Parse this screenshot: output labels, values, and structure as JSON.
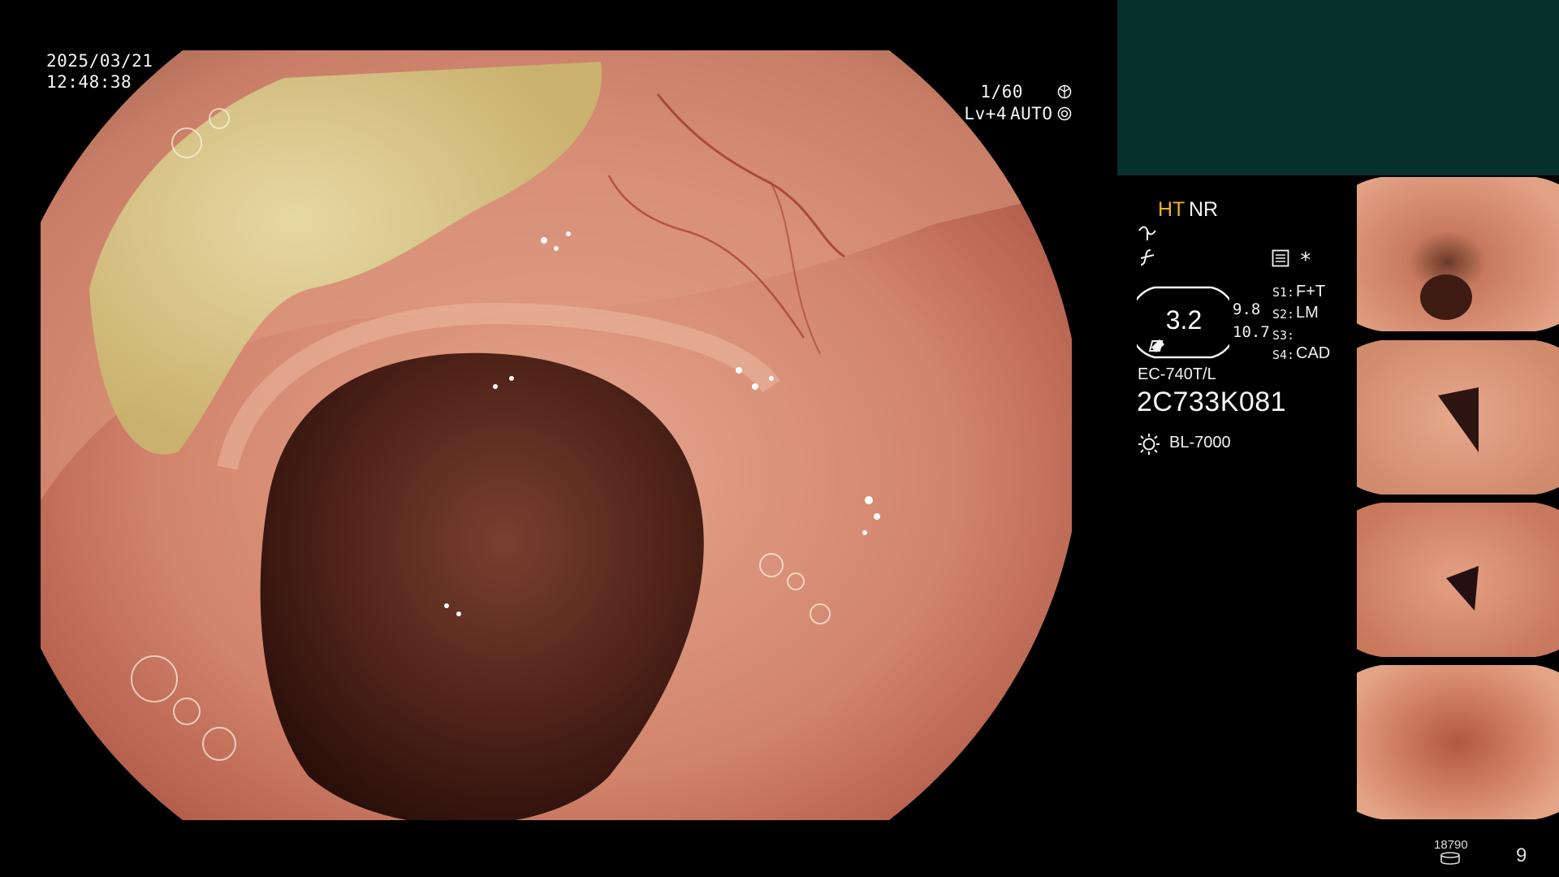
{
  "datetime": {
    "date": "2025/03/21",
    "time": "12:48:38"
  },
  "camera": {
    "shutter": "1/60",
    "level": "Lv+4",
    "mode": "AUTO"
  },
  "settings": {
    "ht": "HT",
    "nr": "NR",
    "enhance_value": "3.2",
    "value_a": "9.8",
    "value_b": "10.7",
    "s1_key": "S1:",
    "s1_val": "F+T",
    "s2_key": "S2:",
    "s2_val": "LM",
    "s3_key": "S3:",
    "s3_val": "",
    "s4_key": "S4:",
    "s4_val": "CAD",
    "asterisk": "*",
    "model": "EC-740T/L",
    "serial": "2C733K081",
    "light": "BL-7000"
  },
  "footer": {
    "count": "18790",
    "page": "9"
  },
  "icons": [
    "shutter-icon",
    "auto-iris-icon",
    "wave-icon",
    "function-icon",
    "menu-icon",
    "light-source-icon",
    "storage-icon"
  ],
  "colors": {
    "ht_label": "#f0b020",
    "panel_teal": "#07312c"
  }
}
